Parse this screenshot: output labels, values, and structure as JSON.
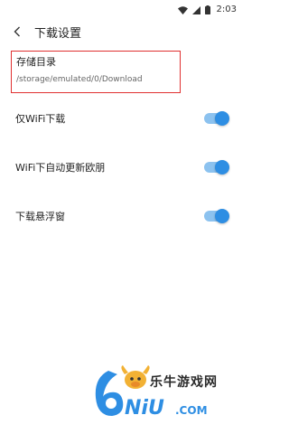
{
  "status_bar": {
    "time": "2:03",
    "icons": [
      "wifi-icon",
      "signal-icon",
      "battery-icon"
    ]
  },
  "header": {
    "back_icon": "chevron-left-icon",
    "title": "下载设置"
  },
  "storage": {
    "title": "存储目录",
    "path": "/storage/emulated/0/Download",
    "highlight_color": "#e03030"
  },
  "settings": [
    {
      "label": "仅WiFi下载",
      "enabled": true
    },
    {
      "label": "WiFi下自动更新欧朋",
      "enabled": true
    },
    {
      "label": "下载悬浮窗",
      "enabled": true
    }
  ],
  "accent_color": "#2e8ee3",
  "watermark": {
    "logo_text": "6NiU",
    "site_name": "乐牛游戏网",
    "domain": ".COM"
  }
}
